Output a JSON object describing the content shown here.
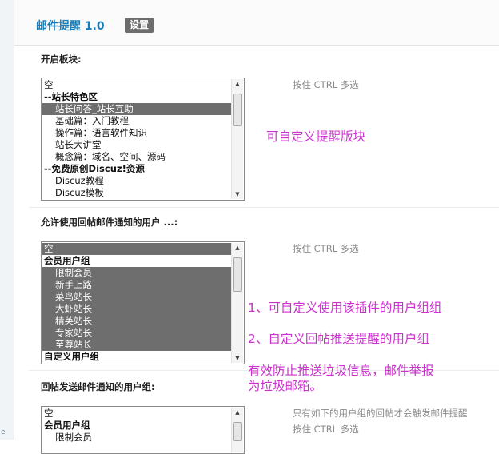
{
  "plugin": {
    "title": "邮件提醒 1.0",
    "settings_label": "设置"
  },
  "sections": [
    {
      "label": "开启板块:",
      "hint": "按住 CTRL 多选",
      "options": [
        {
          "text": "空",
          "type": "item",
          "selected": false
        },
        {
          "text": "--站长特色区",
          "type": "group",
          "selected": false
        },
        {
          "text": "站长问答_站长互助",
          "type": "indent",
          "selected": true
        },
        {
          "text": "基础篇：入门教程",
          "type": "indent",
          "selected": false
        },
        {
          "text": "操作篇：语言软件知识",
          "type": "indent",
          "selected": false
        },
        {
          "text": "站长大讲堂",
          "type": "indent",
          "selected": false
        },
        {
          "text": "概念篇：域名、空间、源码",
          "type": "indent",
          "selected": false
        },
        {
          "text": "--免费原创Discuz!资源",
          "type": "group",
          "selected": false
        },
        {
          "text": "Discuz教程",
          "type": "indent",
          "selected": false
        },
        {
          "text": "Discuz模板",
          "type": "indent",
          "selected": false
        }
      ]
    },
    {
      "label": "允许使用回帖邮件通知的用户 ...:",
      "hint": "按住 CTRL 多选",
      "options": [
        {
          "text": "空",
          "type": "item",
          "selected": true
        },
        {
          "text": "会员用户组",
          "type": "group",
          "selected": false
        },
        {
          "text": "限制会员",
          "type": "indent",
          "selected": true
        },
        {
          "text": "新手上路",
          "type": "indent",
          "selected": true
        },
        {
          "text": "菜鸟站长",
          "type": "indent",
          "selected": true
        },
        {
          "text": "大虾站长",
          "type": "indent",
          "selected": true
        },
        {
          "text": "精英站长",
          "type": "indent",
          "selected": true
        },
        {
          "text": "专家站长",
          "type": "indent",
          "selected": true
        },
        {
          "text": "至尊站长",
          "type": "indent",
          "selected": true
        },
        {
          "text": "自定义用户组",
          "type": "group",
          "selected": false
        }
      ]
    },
    {
      "label": "回帖发送邮件通知的用户组:",
      "hint_line1": "只有如下的用户组的回帖才会触发邮件提醒",
      "hint_line2": "按住 CTRL 多选",
      "options": [
        {
          "text": "空",
          "type": "item",
          "selected": false
        },
        {
          "text": "会员用户组",
          "type": "group",
          "selected": false
        },
        {
          "text": "限制会员",
          "type": "indent",
          "selected": false
        }
      ]
    }
  ],
  "annotations": {
    "forum": "可自定义提醒版块",
    "group1": "1、可自定义使用该插件的用户组组",
    "group2": "2、自定义回帖推送提醒的用户组",
    "spam_line1": "有效防止推送垃圾信息，邮件举报",
    "spam_line2": "为垃圾邮箱。"
  },
  "sidebar": {
    "edge_mark": "e"
  },
  "colors": {
    "accent": "#1b7db8",
    "annotation": "#cc33cc",
    "selection": "#6e6e6e"
  }
}
